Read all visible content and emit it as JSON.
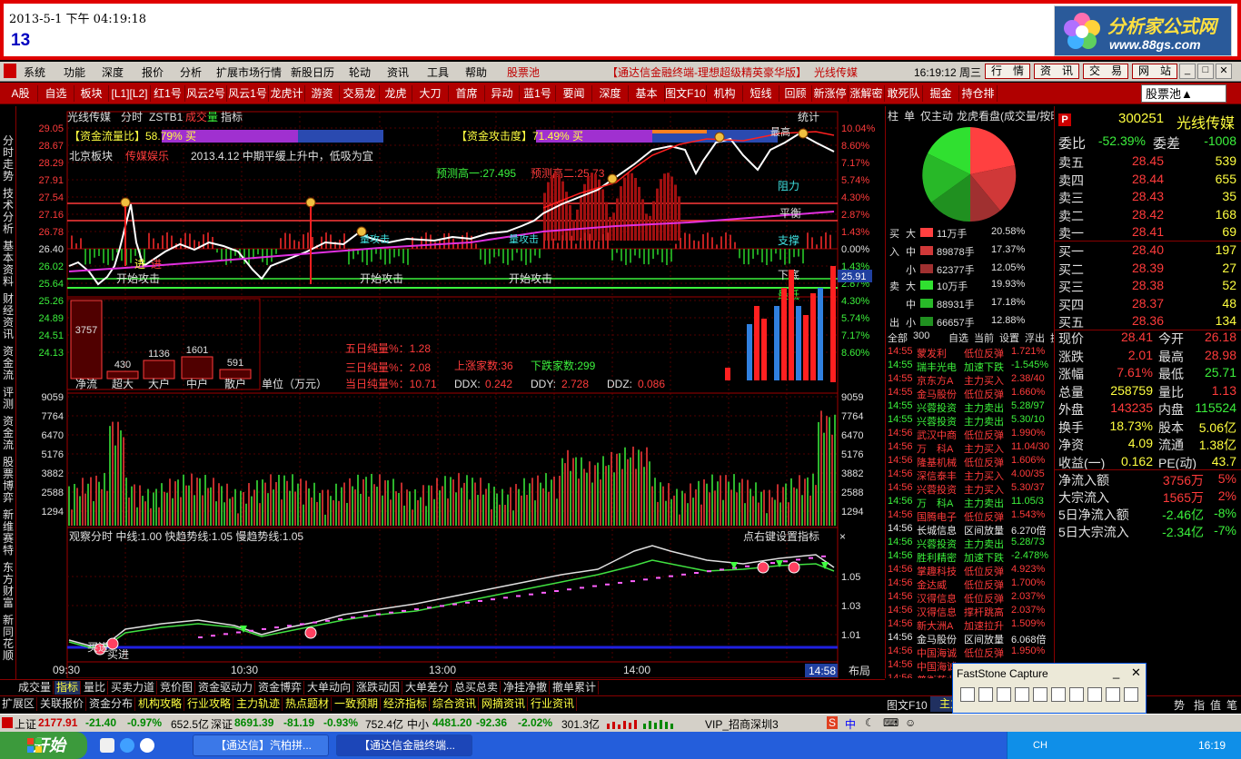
{
  "banner": {
    "datetime": "2013-5-1 下午 04:19:18",
    "number": "13",
    "logo_title": "分析家公式网",
    "logo_url": "www.88gs.com"
  },
  "menu": {
    "items": [
      "系统",
      "功能",
      "深度",
      "报价",
      "分析",
      "扩展市场行情",
      "新股日历",
      "轮动",
      "资讯",
      "工具",
      "帮助"
    ],
    "stock_pool": "股票池",
    "title": "【通达信金融终端-理想超级精英豪华版】",
    "stock_name": "光线传媒",
    "time": "16:19:12 周三",
    "buttons": [
      "行　情",
      "资　讯",
      "交　易",
      "网　站"
    ]
  },
  "toolbar": {
    "items": [
      "A股",
      "自选",
      "板块",
      "[L1][L2]",
      "红1号",
      "风云2号",
      "风云1号",
      "龙虎计",
      "游资",
      "交易龙",
      "龙虎",
      "大刀",
      "首席",
      "异动",
      "蓝1号",
      "要闻",
      "深度",
      "基本",
      "图文F10",
      "机构",
      "短线",
      "回顾",
      "新涨停",
      "涨解密",
      "敢死队",
      "掘金",
      "持仓排"
    ],
    "select_value": "股票池▲"
  },
  "left_tabs": [
    "分时走势",
    "技术分析",
    "基本资料",
    "财经资讯",
    "资金流",
    "评测",
    "资金流",
    "股票博弈",
    "新维赛特",
    "东方财富",
    "新同花顺"
  ],
  "chart": {
    "header": {
      "name": "光线传媒",
      "period": "分时",
      "indicator": "ZSTB1",
      "vol_label_1": "成交",
      "vol_label_2": "量",
      "ind_label": "指标",
      "stats": "统计"
    },
    "left_prices": [
      "29.05",
      "28.67",
      "28.29",
      "27.91",
      "27.54",
      "27.16",
      "26.78",
      "26.40",
      "26.02",
      "25.64",
      "25.26",
      "24.89",
      "24.51",
      "24.13"
    ],
    "right_pcts": [
      "10.04%",
      "8.60%",
      "7.17%",
      "5.74%",
      "4.30%",
      "2.87%",
      "1.43%",
      "0.00%",
      "1.43%",
      "2.87%",
      "4.30%",
      "5.74%",
      "7.17%",
      "8.60%"
    ],
    "current_price_tag": "25.91",
    "bar1_label": "【资金流量比】58.79% 买",
    "bar2_label": "【资金攻击度】71.49% 买",
    "sector_line_1": "北京板块",
    "sector_line_2": "传媒娱乐",
    "sector_line_3": "2013.4.12 中期平缓上升中，低吸为宜",
    "predict_high1": "预测高一:27.495",
    "predict_high2": "预测高二:25.73",
    "labels": {
      "resistance": "阻力",
      "balance": "平衡",
      "support": "支撑",
      "bottom": "下底",
      "lowest": "最低",
      "highest": "最高",
      "attack1": "开始攻击",
      "attack2": "开始攻击",
      "attack3": "开始攻击",
      "qgj1": "量攻击",
      "qgj2": "量攻击",
      "jin1": "进",
      "jin2": "进"
    },
    "funds": {
      "values": [
        "3757",
        "430",
        "1136",
        "1601",
        "591"
      ],
      "labels": [
        "净流",
        "超大",
        "大户",
        "中户",
        "散户"
      ],
      "unit": "单位（万元）"
    },
    "five_day": "五日纯量%：1.28",
    "three_day": "三日纯量%：2.08",
    "today": "当日纯量%：10.71",
    "up_count": "上涨家数:36",
    "down_count": "下跌家数:299",
    "ddx": "DDX:",
    "ddx_v": "0.242",
    "ddy": "DDY:",
    "ddy_v": "2.728",
    "ddz": "DDZ:",
    "ddz_v": "0.086",
    "vol_axis": [
      "9059",
      "7764",
      "6470",
      "5176",
      "3882",
      "2588",
      "1294"
    ],
    "ind_header": "观察分时  中线:1.00  快趋势线:1.05  慢趋势线:1.05",
    "ind_setup": "点右键设置指标",
    "ind_axis": [
      "1.05",
      "1.03",
      "1.01"
    ],
    "ind_labels": {
      "buy1": "买进",
      "buy2": "买进"
    },
    "times": [
      "09:30",
      "10:30",
      "13:00",
      "14:00"
    ],
    "time_tag": "14:58",
    "layout_btn": "布局"
  },
  "panel": {
    "tabs": [
      "柱",
      "单",
      "仅主动",
      "龙虎看盘(成交量/按时"
    ],
    "buy_rows": [
      {
        "side": "买",
        "size": "大",
        "vol": "11万手",
        "pct": "20.58%",
        "color": "#ff4040"
      },
      {
        "side": "入",
        "size": "中",
        "vol": "89878手",
        "pct": "17.37%",
        "color": "#d03838"
      },
      {
        "side": "",
        "size": "小",
        "vol": "62377手",
        "pct": "12.05%",
        "color": "#a03030"
      }
    ],
    "sell_rows": [
      {
        "side": "卖",
        "size": "大",
        "vol": "10万手",
        "pct": "19.93%",
        "color": "#30e030"
      },
      {
        "side": "",
        "size": "中",
        "vol": "88931手",
        "pct": "17.18%",
        "color": "#28b828"
      },
      {
        "side": "出",
        "size": "小",
        "vol": "66657手",
        "pct": "12.88%",
        "color": "#209020"
      }
    ],
    "filter": [
      "全部",
      "300",
      "自选",
      "当前",
      "设置",
      "浮出",
      "扩"
    ],
    "feed": [
      {
        "t": "14:55",
        "n": "蒙发利",
        "a": "低位反弹",
        "v": "1.721%",
        "c": "red"
      },
      {
        "t": "14:55",
        "n": "瑞丰光电",
        "a": "加速下跌",
        "v": "-1.545%",
        "c": "green"
      },
      {
        "t": "14:55",
        "n": "京东方A",
        "a": "主力买入",
        "v": "2.38/40",
        "c": "red"
      },
      {
        "t": "14:55",
        "n": "金马股份",
        "a": "低位反弹",
        "v": "1.660%",
        "c": "red"
      },
      {
        "t": "14:55",
        "n": "兴蓉投资",
        "a": "主力卖出",
        "v": "5.28/97",
        "c": "green"
      },
      {
        "t": "14:55",
        "n": "兴蓉投资",
        "a": "主力卖出",
        "v": "5.30/10",
        "c": "green"
      },
      {
        "t": "14:56",
        "n": "武汉中商",
        "a": "低位反弹",
        "v": "1.990%",
        "c": "red"
      },
      {
        "t": "14:56",
        "n": "万　科A",
        "a": "主力买入",
        "v": "11.04/30",
        "c": "red"
      },
      {
        "t": "14:56",
        "n": "隆基机械",
        "a": "低位反弹",
        "v": "1.606%",
        "c": "red"
      },
      {
        "t": "14:56",
        "n": "深信泰丰",
        "a": "主力买入",
        "v": "4.00/35",
        "c": "red"
      },
      {
        "t": "14:56",
        "n": "兴蓉投资",
        "a": "主力买入",
        "v": "5.30/37",
        "c": "red"
      },
      {
        "t": "14:56",
        "n": "万　科A",
        "a": "主力卖出",
        "v": "11.05/3",
        "c": "green"
      },
      {
        "t": "14:56",
        "n": "国腾电子",
        "a": "低位反弹",
        "v": "1.543%",
        "c": "red"
      },
      {
        "t": "14:56",
        "n": "长城信息",
        "a": "区间放量",
        "v": "6.270倍",
        "c": "white"
      },
      {
        "t": "14:56",
        "n": "兴蓉投资",
        "a": "主力卖出",
        "v": "5.28/73",
        "c": "green"
      },
      {
        "t": "14:56",
        "n": "胜利精密",
        "a": "加速下跌",
        "v": "-2.478%",
        "c": "green"
      },
      {
        "t": "14:56",
        "n": "掌趣科技",
        "a": "低位反弹",
        "v": "4.923%",
        "c": "red"
      },
      {
        "t": "14:56",
        "n": "金达威",
        "a": "低位反弹",
        "v": "1.700%",
        "c": "red"
      },
      {
        "t": "14:56",
        "n": "汉得信息",
        "a": "低位反弹",
        "v": "2.037%",
        "c": "red"
      },
      {
        "t": "14:56",
        "n": "汉得信息",
        "a": "撑杆跳高",
        "v": "2.037%",
        "c": "red"
      },
      {
        "t": "14:56",
        "n": "新大洲A",
        "a": "加速拉升",
        "v": "1.509%",
        "c": "red"
      },
      {
        "t": "14:56",
        "n": "金马股份",
        "a": "区间放量",
        "v": "6.068倍",
        "c": "white"
      },
      {
        "t": "14:56",
        "n": "中国海诚",
        "a": "低位反弹",
        "v": "1.950%",
        "c": "red"
      },
      {
        "t": "14:56",
        "n": "中国海诚",
        "a": "",
        "v": "",
        "c": "red"
      },
      {
        "t": "14:56",
        "n": "普衡药业",
        "a": "",
        "v": "",
        "c": "red"
      }
    ]
  },
  "quote": {
    "code": "300251",
    "name": "光线传媒",
    "weibi_l": "委比",
    "weibi_v": "-52.39%",
    "weicha_l": "委差",
    "weicha_v": "-1008",
    "sells": [
      {
        "l": "卖五",
        "p": "28.45",
        "v": "539"
      },
      {
        "l": "卖四",
        "p": "28.44",
        "v": "655"
      },
      {
        "l": "卖三",
        "p": "28.43",
        "v": "35"
      },
      {
        "l": "卖二",
        "p": "28.42",
        "v": "168"
      },
      {
        "l": "卖一",
        "p": "28.41",
        "v": "69"
      }
    ],
    "buys": [
      {
        "l": "买一",
        "p": "28.40",
        "v": "197"
      },
      {
        "l": "买二",
        "p": "28.39",
        "v": "27"
      },
      {
        "l": "买三",
        "p": "28.38",
        "v": "52"
      },
      {
        "l": "买四",
        "p": "28.37",
        "v": "48"
      },
      {
        "l": "买五",
        "p": "28.36",
        "v": "134"
      }
    ],
    "stats": [
      {
        "l1": "现价",
        "v1": "28.41",
        "c1": "red",
        "l2": "今开",
        "v2": "26.18",
        "c2": "red"
      },
      {
        "l1": "涨跌",
        "v1": "2.01",
        "c1": "red",
        "l2": "最高",
        "v2": "28.98",
        "c2": "red"
      },
      {
        "l1": "涨幅",
        "v1": "7.61%",
        "c1": "red",
        "l2": "最低",
        "v2": "25.71",
        "c2": "green"
      },
      {
        "l1": "总量",
        "v1": "258759",
        "c1": "yellow",
        "l2": "量比",
        "v2": "1.13",
        "c2": "red"
      },
      {
        "l1": "外盘",
        "v1": "143235",
        "c1": "red",
        "l2": "内盘",
        "v2": "115524",
        "c2": "green"
      },
      {
        "l1": "换手",
        "v1": "18.73%",
        "c1": "yellow",
        "l2": "股本",
        "v2": "5.06亿",
        "c2": "yellow"
      },
      {
        "l1": "净资",
        "v1": "4.09",
        "c1": "yellow",
        "l2": "流通",
        "v2": "1.38亿",
        "c2": "yellow"
      },
      {
        "l1": "收益(一)",
        "v1": "0.162",
        "c1": "yellow",
        "l2": "PE(动)",
        "v2": "43.7",
        "c2": "yellow"
      }
    ],
    "flows": [
      {
        "l": "净流入额",
        "v": "3756万",
        "p": "5%",
        "c": "red"
      },
      {
        "l": "大宗流入",
        "v": "1565万",
        "p": "2%",
        "c": "red"
      },
      {
        "l": "5日净流入额",
        "v": "-2.46亿",
        "p": "-8%",
        "c": "green"
      },
      {
        "l": "5日大宗流入",
        "v": "-2.34亿",
        "p": "-7%",
        "c": "green"
      }
    ]
  },
  "bottom_tabs_1": [
    "成交量",
    "指标",
    "量比",
    "买卖力道",
    "竞价图",
    "资金驱动力",
    "资金博弈",
    "大单动向",
    "涨跌动因",
    "大单差分",
    "总买总卖",
    "净挂净撤",
    "撤单累计"
  ],
  "bottom_tabs_2": [
    "扩展区",
    "关联报价",
    "资金分布",
    "机构攻略",
    "行业攻略",
    "主力轨迹",
    "热点题材",
    "一致预期",
    "经济指标",
    "综合资讯",
    "网摘资讯",
    "行业资讯"
  ],
  "right_bottom_tabs": [
    "图文F10",
    "主力",
    "分"
  ],
  "right_bottom_tabs2": [
    "势",
    "指",
    "值",
    "笔"
  ],
  "statusbar": {
    "sh_label": "上证",
    "sh_idx": "2177.91",
    "sh_chg": "-21.40",
    "sh_pct": "-0.97%",
    "sh_amt": "652.5亿",
    "sz_label": "深证",
    "sz_idx": "8691.39",
    "sz_chg": "-81.19",
    "sz_pct": "-0.93%",
    "sz_amt": "752.4亿",
    "zx_label": "中小",
    "zx_idx": "4481.20",
    "zx_chg": "-92.36",
    "zx_pct": "-2.02%",
    "zx_amt": "301.3亿",
    "vip": "VIP_招商深圳3"
  },
  "taskbar": {
    "start": "开始",
    "tasks": [
      "【通达信】汽柏拼...",
      "【通达信金融终端..."
    ],
    "tray_lang": "CH",
    "clock": "16:19"
  },
  "fastwin": {
    "title": "FastStone Capture"
  }
}
